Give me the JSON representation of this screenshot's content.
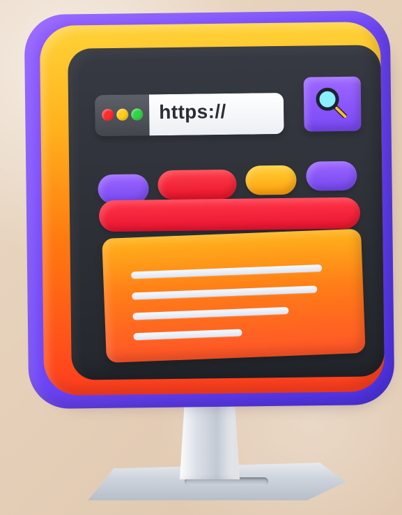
{
  "browser": {
    "url_text": "https://"
  },
  "icons": {
    "search": "search-icon"
  },
  "colors": {
    "background": "#e7d3bf",
    "outer_frame": "#6b43f6",
    "inner_frame": "#ff8a12",
    "screen": "#2d3037",
    "accent_purple": "#8c59ff",
    "accent_red": "#f11f35",
    "accent_yellow": "#ffbf24",
    "content_orange": "#ff7b18"
  }
}
